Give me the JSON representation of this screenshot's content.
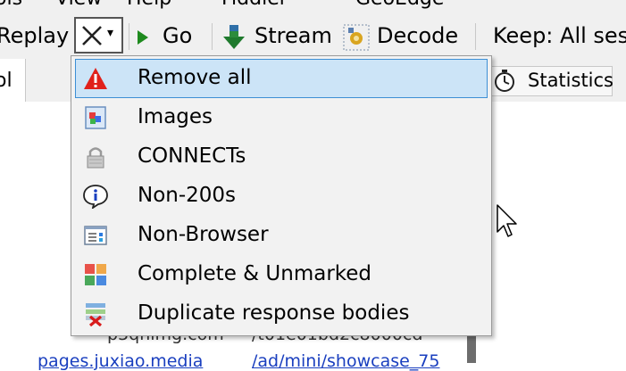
{
  "menubar": {
    "items": [
      "ols",
      "View",
      "Help",
      "Fiddler",
      "GeoEdge"
    ]
  },
  "toolbar": {
    "replay_label": "Replay",
    "remove_dropdown_caret": "▾",
    "go_label": "Go",
    "stream_label": "Stream",
    "decode_label": "Decode",
    "keep_label": "Keep: All ses"
  },
  "tabs": {
    "left_fragment": "ol",
    "statistics_label": "Statistics"
  },
  "list_rows": [
    {
      "host": "p3qhimg.com",
      "url": "/t01e01bd2c8000cd"
    },
    {
      "host": "pages.juxiao.media",
      "url": "/ad/mini/showcase_75"
    }
  ],
  "menu": {
    "items": [
      {
        "label": "Remove all",
        "icon": "warning-icon",
        "highlighted": true
      },
      {
        "label": "Images",
        "icon": "image-icon"
      },
      {
        "label": "CONNECTs",
        "icon": "lock-icon"
      },
      {
        "label": "Non-200s",
        "icon": "info-bubble-icon"
      },
      {
        "label": "Non-Browser",
        "icon": "window-icon"
      },
      {
        "label": "Complete & Unmarked",
        "icon": "grid-icon"
      },
      {
        "label": "Duplicate response bodies",
        "icon": "duplicate-remove-icon"
      }
    ]
  },
  "colors": {
    "highlight_bg": "#cce4f7",
    "highlight_border": "#3d8fd4",
    "warning_red": "#e0211b",
    "go_green": "#1e8a1e",
    "link_blue": "#1a3fbf"
  }
}
